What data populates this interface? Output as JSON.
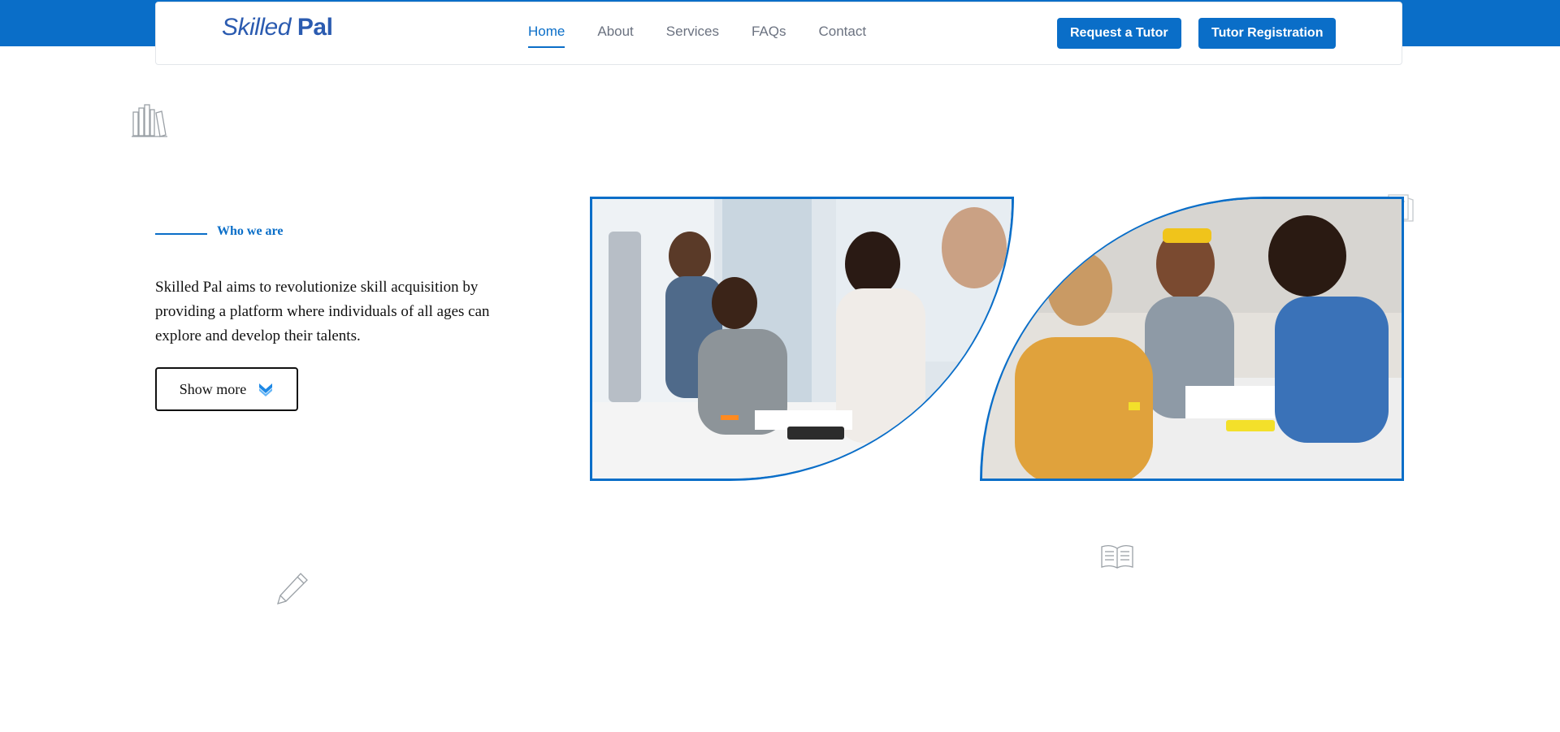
{
  "brand": {
    "logo_part1": "Skilled",
    "logo_part2": "Pal"
  },
  "nav": {
    "links": [
      "Home",
      "About",
      "Services",
      "FAQs",
      "Contact"
    ],
    "active": "Home"
  },
  "header_buttons": {
    "request": "Request a Tutor",
    "register": "Tutor Registration"
  },
  "about": {
    "eyebrow": "Who we are",
    "text": "Skilled Pal aims to revolutionize skill acquisition by providing a platform where individuals of all ages can explore and develop their talents.",
    "button_label": "Show more",
    "button_icon": "double-chevron-down-icon"
  },
  "images": [
    {
      "icon": "team-meeting-photo"
    },
    {
      "icon": "students-studying-photo"
    }
  ],
  "decorations": [
    "books-icon",
    "book-stand-icon",
    "open-book-icon",
    "pencil-icon"
  ],
  "colors": {
    "primary": "#0a6ec8",
    "logo": "#2b5bb0",
    "nav_text": "#6b7280"
  }
}
